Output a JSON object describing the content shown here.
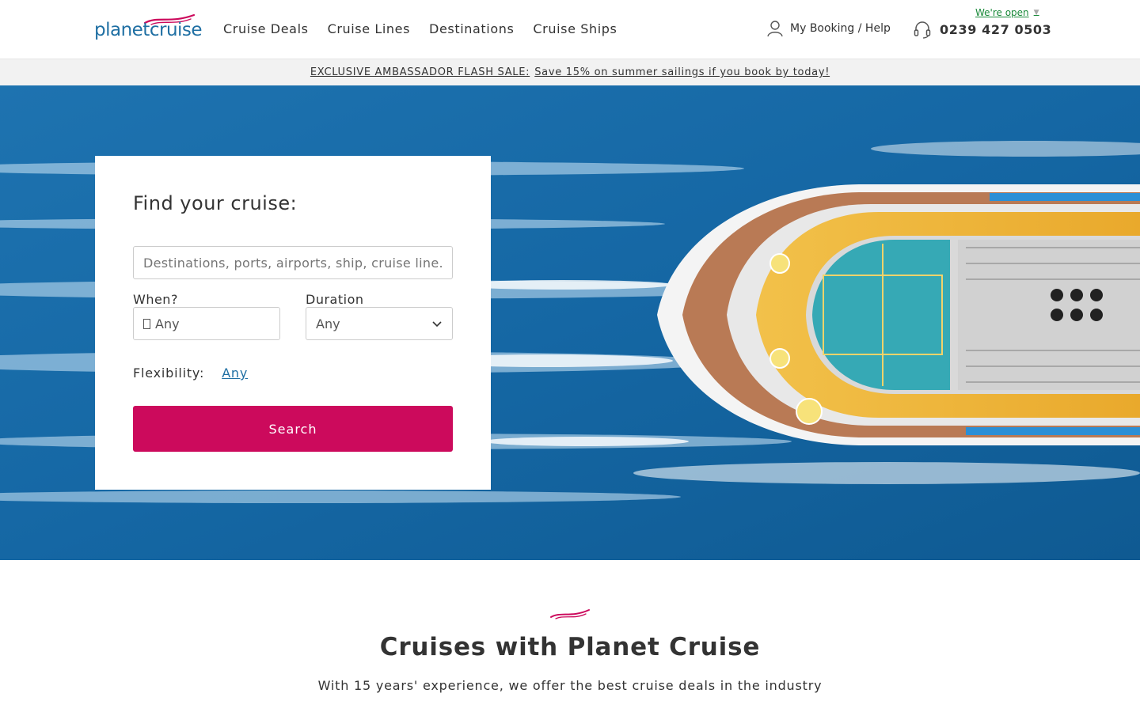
{
  "brand": {
    "logo_text_planet": "planet",
    "logo_text_cruise": "cruise",
    "accent": "#cc0a5c",
    "primary": "#1f6fa3"
  },
  "nav": {
    "items": [
      "Cruise Deals",
      "Cruise Lines",
      "Destinations",
      "Cruise Ships"
    ]
  },
  "header": {
    "booking_label": "My Booking / Help",
    "open_status": "We're open",
    "phone": "0239 427 0503",
    "user_icon": "user-icon",
    "phone_icon": "headset-icon"
  },
  "promo": {
    "label": "EXCLUSIVE AMBASSADOR FLASH SALE:",
    "message": "Save 15% on summer sailings if you book by today!"
  },
  "search": {
    "title": "Find your cruise:",
    "placeholder": "Destinations, ports, airports, ship, cruise line...",
    "when_label": "When?",
    "when_value": "Any",
    "duration_label": "Duration",
    "duration_value": "Any",
    "flex_label": "Flexibility:",
    "flex_value": "Any",
    "button": "Search"
  },
  "intro": {
    "title": "Cruises with Planet Cruise",
    "subtitle": "With 15 years' experience, we offer the best cruise deals in the industry"
  }
}
